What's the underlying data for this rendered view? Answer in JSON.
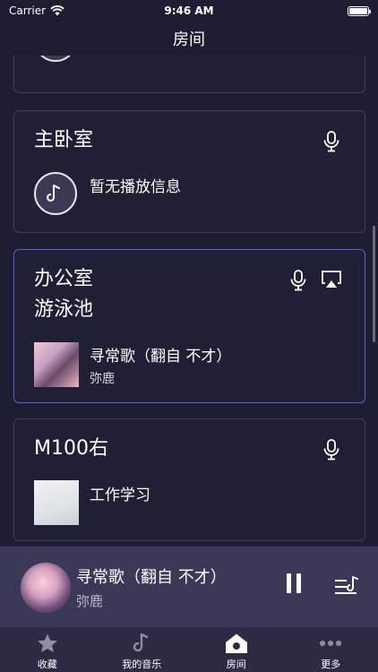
{
  "status_bar": {
    "carrier": "Carrier",
    "time": "9:46 AM"
  },
  "nav": {
    "title": "房间"
  },
  "rooms": [
    {
      "name": "主卧室",
      "now_playing": "暂无播放信息",
      "icons": [
        "mic-icon"
      ],
      "cover": "music-note-icon"
    },
    {
      "name": "办公室",
      "name2": "游泳池",
      "selected": true,
      "song": "寻常歌（翻自 不才）",
      "artist": "弥鹿",
      "icons": [
        "mic-icon",
        "airplay-icon"
      ],
      "cover": "portrait-cover"
    },
    {
      "name": "M100右",
      "song": "工作学习",
      "icons": [
        "mic-icon"
      ],
      "cover": "white-paper-cover"
    }
  ],
  "player": {
    "title": "寻常歌（翻自 不才）",
    "artist": "弥鹿"
  },
  "tabs": [
    {
      "label": "收藏",
      "icon": "star-icon"
    },
    {
      "label": "我的音乐",
      "icon": "music-note-icon"
    },
    {
      "label": "房间",
      "icon": "home-icon",
      "active": true
    },
    {
      "label": "更多",
      "icon": "more-dots-icon"
    }
  ],
  "colors": {
    "background": "#1d1d33",
    "card_border": "#3f3f5c",
    "active_border": "#5b5fd8",
    "player_bg": "#3a3a58",
    "tab_bg": "#2b2b44"
  }
}
